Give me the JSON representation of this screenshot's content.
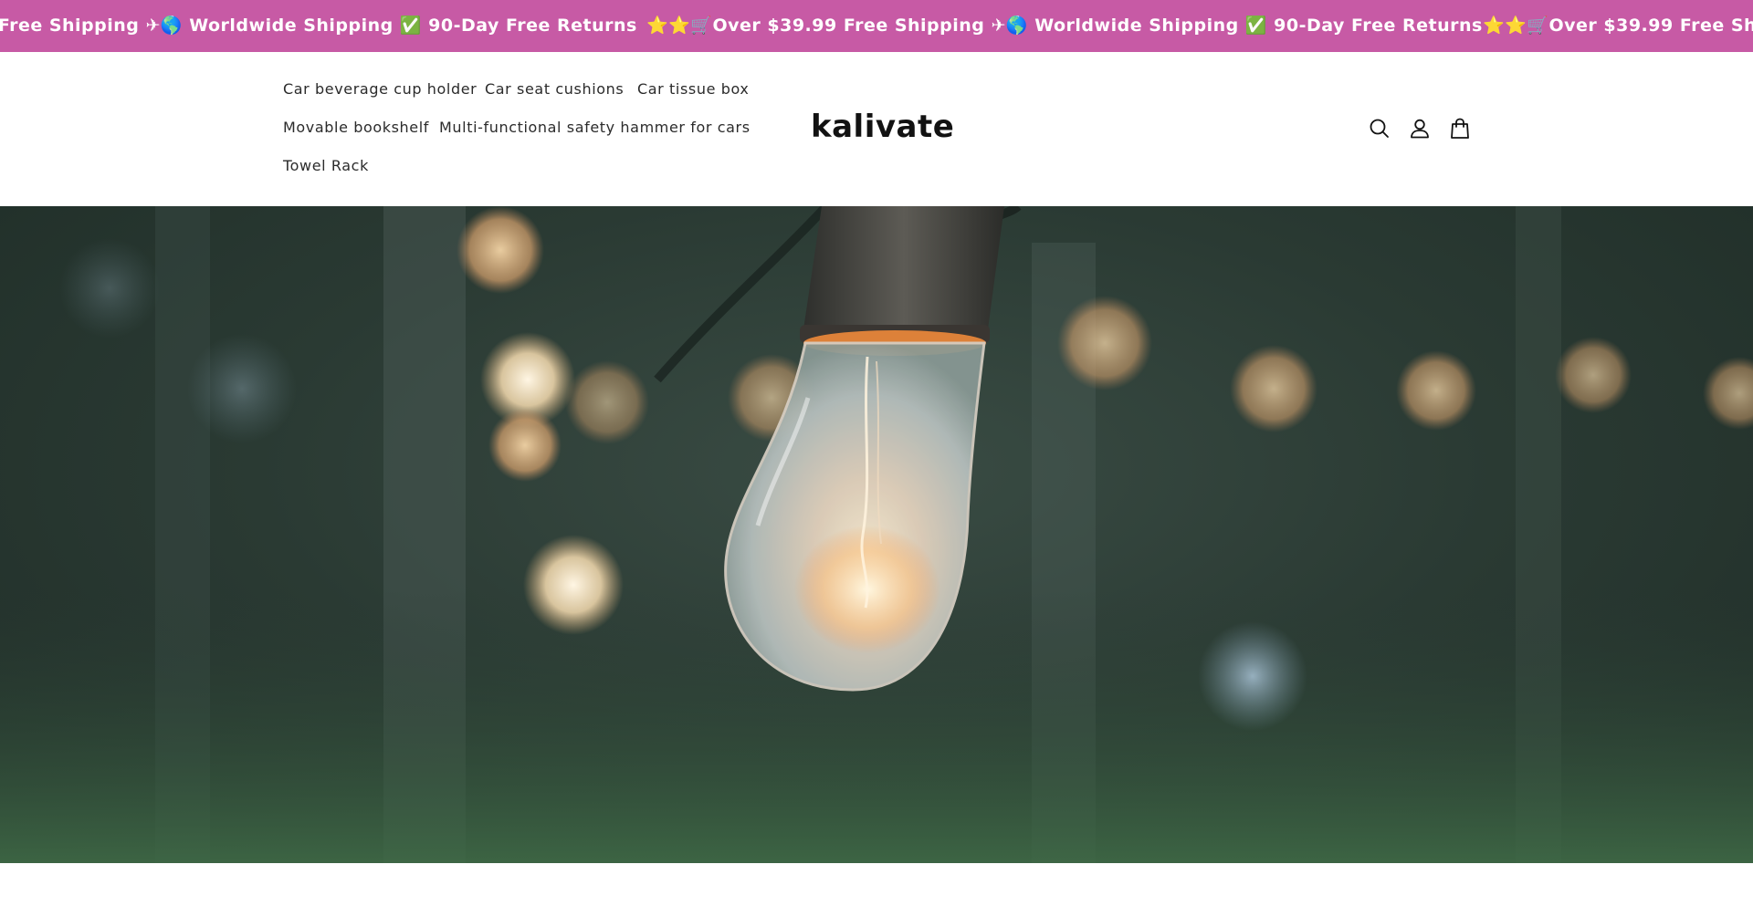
{
  "announcement": {
    "text": "⭐⭐🛒Over $39.99 Free Shipping ✈🌎 Worldwide Shipping ✅ 90-Day Free Returns",
    "background_color": "#c75aa5"
  },
  "header": {
    "nav": [
      {
        "label": "Car beverage cup holder"
      },
      {
        "label": "Car seat cushions"
      },
      {
        "label": "Car tissue box"
      },
      {
        "label": "Movable bookshelf"
      },
      {
        "label": "Multi-functional safety hammer for cars"
      },
      {
        "label": "Towel Rack"
      }
    ],
    "logo": "kalivate",
    "icons": [
      "search-icon",
      "account-icon",
      "cart-icon"
    ]
  },
  "hero": {
    "image": "light-bulb-bokeh-image"
  }
}
